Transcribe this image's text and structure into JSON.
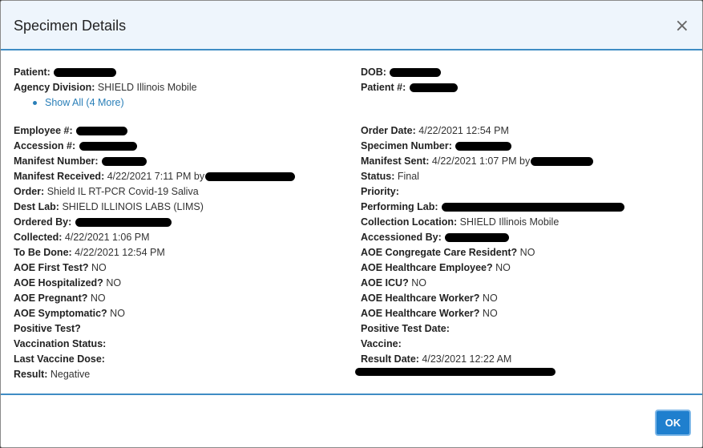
{
  "modal": {
    "title": "Specimen Details",
    "close_glyph": "×"
  },
  "left_top": [
    {
      "label": "Patient:",
      "value": "",
      "redacted": true
    },
    {
      "label": "Agency Division:",
      "value": "SHIELD Illinois Mobile"
    }
  ],
  "show_all_link": "Show All (4 More)",
  "right_top": [
    {
      "label": "DOB:",
      "value": "",
      "redacted": true
    },
    {
      "label": "Patient #:",
      "value": "",
      "redacted": true
    }
  ],
  "left_fields": [
    {
      "label": "Employee #:",
      "value": "",
      "redacted": true
    },
    {
      "label": "Accession #:",
      "value": "",
      "redacted": true
    },
    {
      "label": "Manifest Number:",
      "value": "",
      "redacted": true
    },
    {
      "label": "Manifest Received:",
      "value": "4/22/2021 7:11 PM by",
      "redacted": true
    },
    {
      "label": "Order:",
      "value": "Shield IL RT-PCR Covid-19 Saliva"
    },
    {
      "label": "Dest Lab:",
      "value": "SHIELD ILLINOIS LABS (LIMS)"
    },
    {
      "label": "Ordered By:",
      "value": "",
      "redacted": true
    },
    {
      "label": "Collected:",
      "value": "4/22/2021 1:06 PM"
    },
    {
      "label": "To Be Done:",
      "value": "4/22/2021 12:54 PM"
    },
    {
      "label": "AOE First Test?",
      "value": "NO"
    },
    {
      "label": "AOE Hospitalized?",
      "value": "NO"
    },
    {
      "label": "AOE Pregnant?",
      "value": "NO"
    },
    {
      "label": "AOE Symptomatic?",
      "value": "NO"
    },
    {
      "label": "Positive Test?",
      "value": ""
    },
    {
      "label": "Vaccination Status:",
      "value": ""
    },
    {
      "label": "Last Vaccine Dose:",
      "value": ""
    },
    {
      "label": "Result:",
      "value": "Negative"
    }
  ],
  "right_fields": [
    {
      "label": "Order Date:",
      "value": "4/22/2021 12:54 PM"
    },
    {
      "label": "Specimen Number:",
      "value": "",
      "redacted": true
    },
    {
      "label": "Manifest Sent:",
      "value": "4/22/2021 1:07 PM by",
      "redacted": true
    },
    {
      "label": "Status:",
      "value": "Final"
    },
    {
      "label": "Priority:",
      "value": ""
    },
    {
      "label": "Performing Lab:",
      "value": "",
      "redacted": true
    },
    {
      "label": "Collection Location:",
      "value": "SHIELD Illinois Mobile"
    },
    {
      "label": "Accessioned By:",
      "value": "",
      "redacted": true
    },
    {
      "label": "AOE Congregate Care Resident?",
      "value": "NO"
    },
    {
      "label": "AOE Healthcare Employee?",
      "value": "NO"
    },
    {
      "label": "AOE ICU?",
      "value": "NO"
    },
    {
      "label": "AOE Healthcare Worker?",
      "value": "NO"
    },
    {
      "label": "AOE Healthcare Worker?",
      "value": "NO"
    },
    {
      "label": "Positive Test Date:",
      "value": ""
    },
    {
      "label": "Vaccine:",
      "value": ""
    },
    {
      "label": "Result Date:",
      "value": "4/23/2021 12:22 AM"
    }
  ],
  "footer": {
    "ok_label": "OK"
  },
  "colors": {
    "accent": "#3f8cc4",
    "button": "#1f7fce",
    "link": "#2a7fb8",
    "header_bg": "#eef5fc"
  }
}
